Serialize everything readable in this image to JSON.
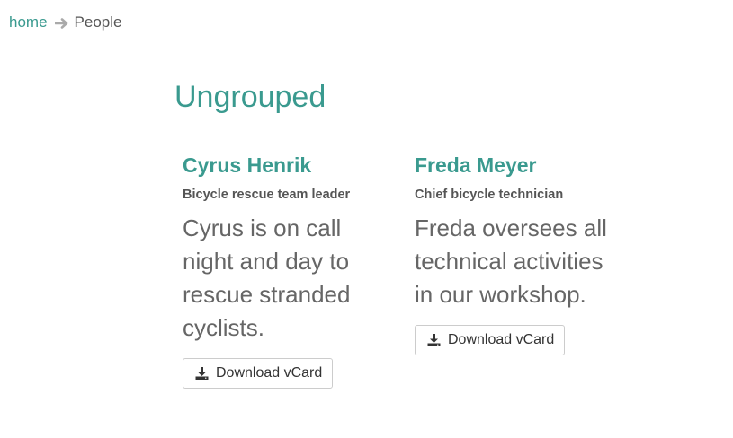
{
  "breadcrumb": {
    "home": "home",
    "separator_icon": "arrow-right-icon",
    "current": "People"
  },
  "group": {
    "title": "Ungrouped"
  },
  "people": [
    {
      "name": "Cyrus Henrik",
      "role": "Bicycle rescue team leader",
      "bio": "Cyrus is on call night and day to rescue stranded cyclists.",
      "button_label": "Download vCard",
      "button_icon": "download-icon"
    },
    {
      "name": "Freda Meyer",
      "role": "Chief bicycle technician",
      "bio": "Freda oversees all technical activities in our workshop.",
      "button_label": "Download vCard",
      "button_icon": "download-icon"
    }
  ],
  "colors": {
    "accent": "#3a9a8f",
    "text": "#555555",
    "arrow": "#aaaaaa"
  }
}
